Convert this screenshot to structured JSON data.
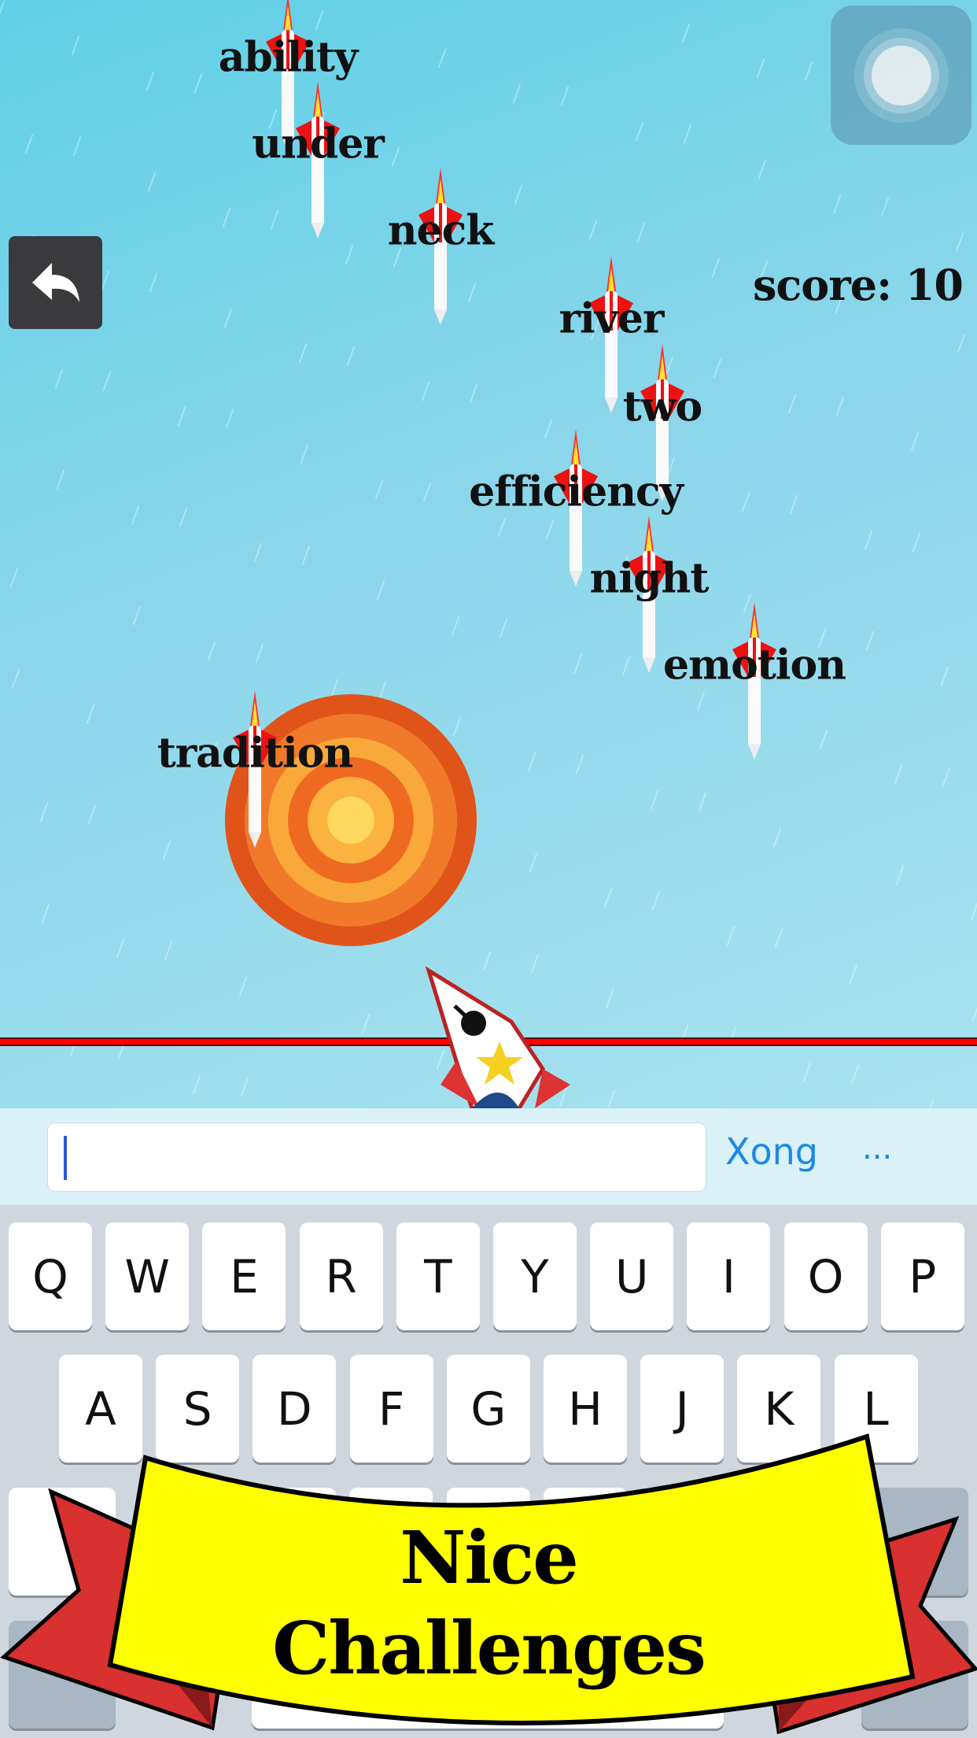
{
  "game": {
    "score_label": "score: 10",
    "words": [
      {
        "text": "ability"
      },
      {
        "text": "under"
      },
      {
        "text": "neck"
      },
      {
        "text": "river"
      },
      {
        "text": "two"
      },
      {
        "text": "efficiency"
      },
      {
        "text": "night"
      },
      {
        "text": "emotion"
      },
      {
        "text": "tradition"
      }
    ],
    "back_icon": "undo-arrow-icon",
    "pause_icon": "assistive-touch-icon",
    "colors": {
      "danger_line": "#ff0000",
      "missile_fin": "#ee1111",
      "water": "#7fd3e8"
    }
  },
  "input_bar": {
    "value": "",
    "done_label": "Xong",
    "more_label": "..."
  },
  "keyboard": {
    "row1": [
      "Q",
      "W",
      "E",
      "R",
      "T",
      "Y",
      "U",
      "I",
      "O",
      "P"
    ],
    "row2": [
      "A",
      "S",
      "D",
      "F",
      "G",
      "H",
      "J",
      "K",
      "L"
    ]
  },
  "banner": {
    "line1": "Nice",
    "line2": "Challenges",
    "colors": {
      "fill": "#ffff00",
      "ribbon": "#d93030"
    }
  }
}
